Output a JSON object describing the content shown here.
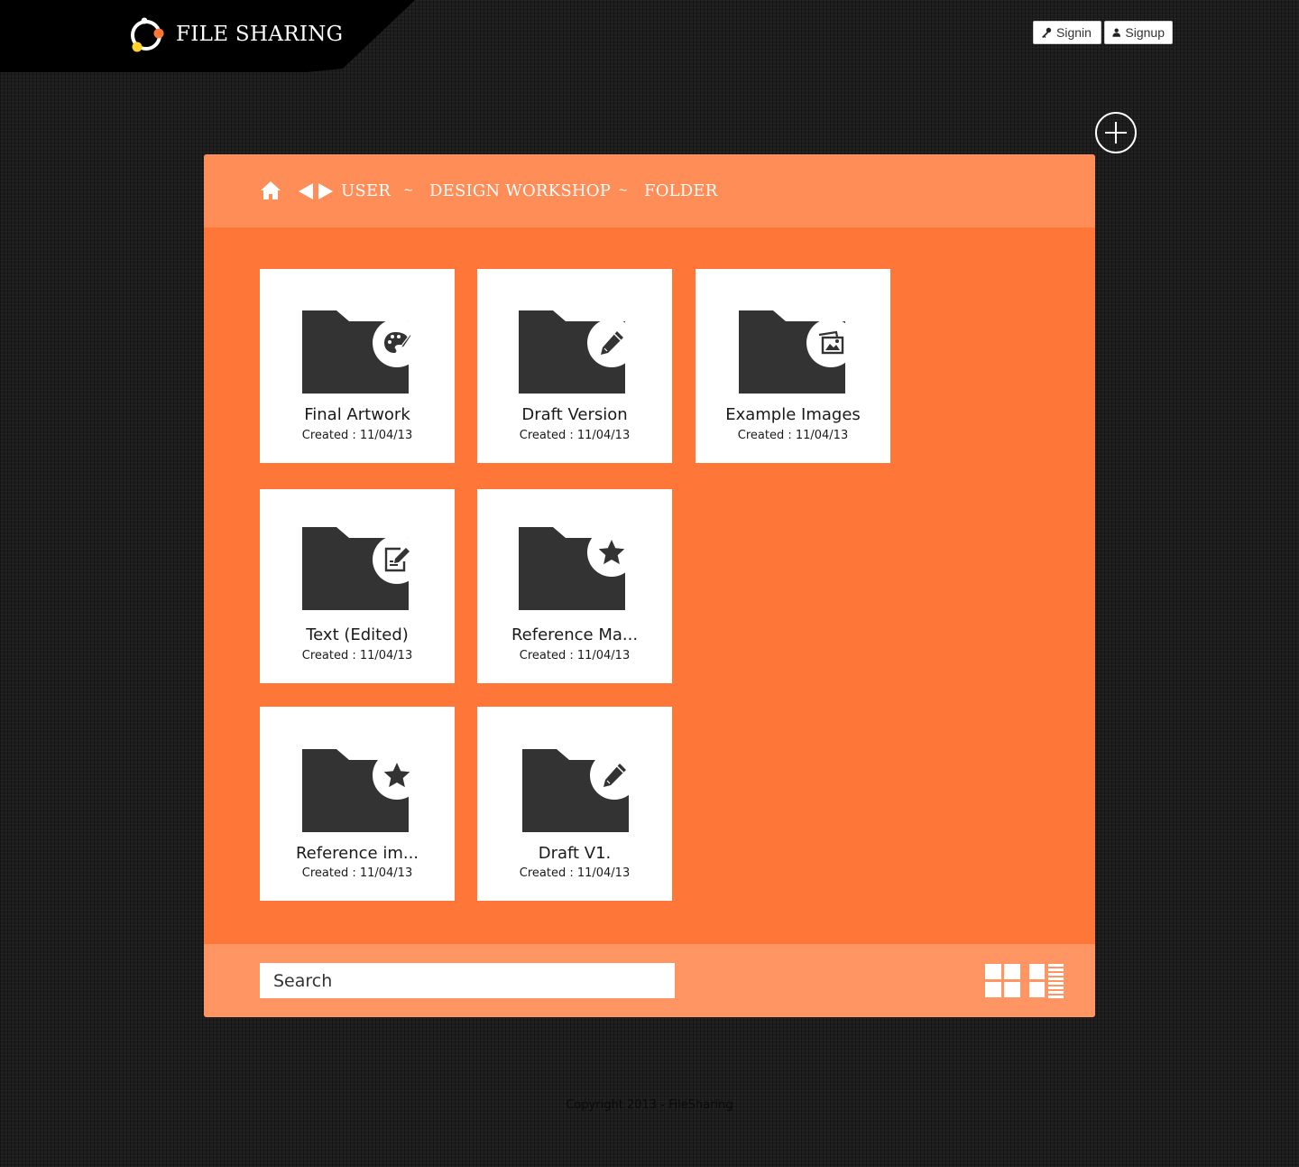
{
  "header": {
    "brand": "FILE SHARING",
    "signin_label": "Signin",
    "signup_label": "Signup"
  },
  "breadcrumb": {
    "items": [
      "USER",
      "DESIGN WORKSHOP",
      "FOLDER"
    ],
    "separator": "~"
  },
  "folders": [
    {
      "title": "Final Artwork",
      "date": "Created : 11/04/13",
      "icon": "palette-icon"
    },
    {
      "title": "Draft Version",
      "date": "Created : 11/04/13",
      "icon": "pencil-icon"
    },
    {
      "title": "Example Images",
      "date": "Created : 11/04/13",
      "icon": "images-icon"
    },
    {
      "title": "Text (Edited)",
      "date": "Created : 11/04/13",
      "icon": "edit-document-icon"
    },
    {
      "title": "Reference Ma...",
      "date": "Created : 11/04/13",
      "icon": "star-icon"
    },
    {
      "title": "Reference im...",
      "date": "Created : 11/04/13",
      "icon": "star-icon"
    },
    {
      "title": "Draft V1.",
      "date": "Created : 11/04/13",
      "icon": "pencil-icon"
    }
  ],
  "search": {
    "placeholder": "Search"
  },
  "footer": {
    "copyright": "Copyright 2013 - FileSharing"
  },
  "colors": {
    "accent": "#ff7639",
    "breadcrumb_bar": "#ff8d57",
    "footer_bar": "#ff9563",
    "folder": "#333333",
    "logo_orange": "#ff7639",
    "logo_yellow": "#ffd02a"
  }
}
